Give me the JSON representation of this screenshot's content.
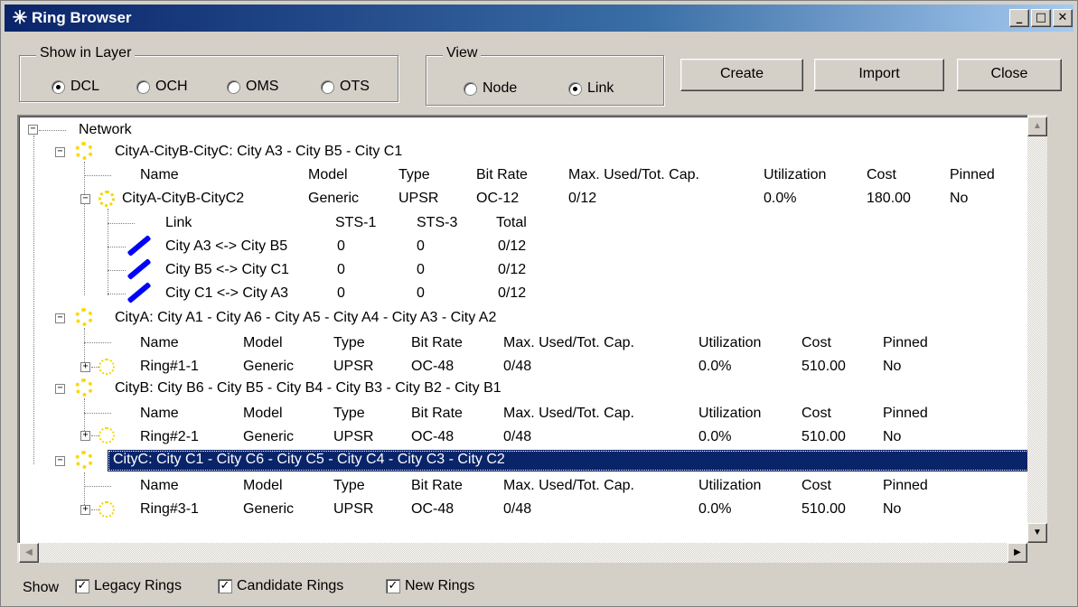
{
  "window": {
    "title": "Ring Browser",
    "minimize_glyph": "_",
    "maximize_glyph": "□",
    "close_glyph": "✕"
  },
  "show_in_layer": {
    "label": "Show in Layer",
    "options": [
      "DCL",
      "OCH",
      "OMS",
      "OTS"
    ],
    "selected": "DCL"
  },
  "view": {
    "label": "View",
    "options": [
      "Node",
      "Link"
    ],
    "selected": "Link"
  },
  "buttons": {
    "create": "Create",
    "import": "Import",
    "close": "Close"
  },
  "tree": {
    "root": "Network",
    "groups": [
      {
        "label": "CityA-CityB-CityC: City A3 - City B5 - City C1",
        "headers": [
          "Name",
          "Model",
          "Type",
          "Bit Rate",
          "Max. Used/Tot. Cap.",
          "Utilization",
          "Cost",
          "Pinned"
        ],
        "ring": [
          "CityA-CityB-CityC2",
          "Generic",
          "UPSR",
          "OC-12",
          "0/12",
          "0.0%",
          "180.00",
          "No"
        ],
        "link_headers": [
          "Link",
          "STS-1",
          "STS-3",
          "Total"
        ],
        "links": [
          [
            "City A3 <-> City B5",
            "0",
            "0",
            "0/12"
          ],
          [
            "City B5 <-> City C1",
            "0",
            "0",
            "0/12"
          ],
          [
            "City C1 <-> City A3",
            "0",
            "0",
            "0/12"
          ]
        ]
      },
      {
        "label": "CityA: City A1 - City A6 - City A5 - City A4 - City A3 - City A2",
        "headers": [
          "Name",
          "Model",
          "Type",
          "Bit Rate",
          "Max. Used/Tot. Cap.",
          "Utilization",
          "Cost",
          "Pinned"
        ],
        "ring": [
          "Ring#1-1",
          "Generic",
          "UPSR",
          "OC-48",
          "0/48",
          "0.0%",
          "510.00",
          "No"
        ]
      },
      {
        "label": "CityB: City B6 - City B5 - City B4 - City B3 - City B2 - City B1",
        "headers": [
          "Name",
          "Model",
          "Type",
          "Bit Rate",
          "Max. Used/Tot. Cap.",
          "Utilization",
          "Cost",
          "Pinned"
        ],
        "ring": [
          "Ring#2-1",
          "Generic",
          "UPSR",
          "OC-48",
          "0/48",
          "0.0%",
          "510.00",
          "No"
        ]
      },
      {
        "label": "CityC: City C1 - City C6 - City C5 - City C4 - City C3 - City C2",
        "headers": [
          "Name",
          "Model",
          "Type",
          "Bit Rate",
          "Max. Used/Tot. Cap.",
          "Utilization",
          "Cost",
          "Pinned"
        ],
        "ring": [
          "Ring#3-1",
          "Generic",
          "UPSR",
          "OC-48",
          "0/48",
          "0.0%",
          "510.00",
          "No"
        ]
      }
    ]
  },
  "footer": {
    "show_label": "Show",
    "checkboxes": [
      "Legacy Rings",
      "Candidate Rings",
      "New Rings"
    ],
    "checked": [
      true,
      true,
      true
    ]
  },
  "colors": {
    "title_bar": "#0a246a",
    "selection": "#0a246a",
    "ring_icon": "#f2d700",
    "link_icon": "#0000ff"
  }
}
